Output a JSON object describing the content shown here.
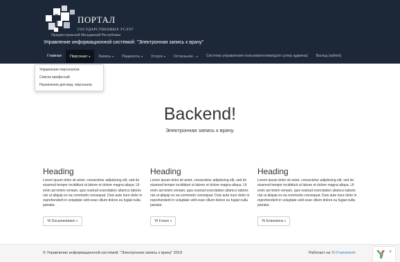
{
  "header": {
    "logo": {
      "title": "ПОРТАЛ",
      "subtitle_line1": "ГОСУДАРСТВЕННЫХ УСЛУГ",
      "subtitle_line2": "Приднестровской Молдавской Республики"
    },
    "system_title": "Управление информационной системой: \"Электронная запись к врачу\""
  },
  "nav": {
    "items": [
      {
        "label": "Главная",
        "has_caret": false
      },
      {
        "label": "Персонал",
        "has_caret": true
      },
      {
        "label": "Запись",
        "has_caret": true
      },
      {
        "label": "Пациенты",
        "has_caret": true
      },
      {
        "label": "Услуги",
        "has_caret": true
      },
      {
        "label": "Остальное..",
        "has_caret": true
      },
      {
        "label": "Система управления пользователями(для супер админа)",
        "has_caret": false
      },
      {
        "label": "Выход (admin)",
        "has_caret": false
      }
    ],
    "caret": "▾",
    "active": "Персонал"
  },
  "dropdown": {
    "items": [
      "Управление персоналом",
      "Список профессий",
      "Назначения для мед. персонала"
    ]
  },
  "jumbotron": {
    "heading": "Backend!",
    "lead": "Электронная запись к врачу."
  },
  "columns": [
    {
      "heading": "Heading",
      "text": "Lorem ipsum dolor sit amet, consectetur adipisicing elit, sed do eiusmod tempor incididunt ut labore et dolore magna aliqua. Ut enim ad minim veniam, quis nostrud exercitation ullamco laboris nisi ut aliquip ex ea commodo consequat. Duis aute irure dolor in reprehenderit in voluptate velit esse cillum dolore eu fugiat nulla pariatur.",
      "button": "Yii Documentation »"
    },
    {
      "heading": "Heading",
      "text": "Lorem ipsum dolor sit amet, consectetur adipisicing elit, sed do eiusmod tempor incididunt ut labore et dolore magna aliqua. Ut enim ad minim veniam, quis nostrud exercitation ullamco laboris nisi ut aliquip ex ea commodo consequat. Duis aute irure dolor in reprehenderit in voluptate velit esse cillum dolore eu fugiat nulla pariatur.",
      "button": "Yii Forum »"
    },
    {
      "heading": "Heading",
      "text": "Lorem ipsum dolor sit amet, consectetur adipisicing elit, sed do eiusmod tempor incididunt ut labore et dolore magna aliqua. Ut enim ad minim veniam, quis nostrud exercitation ullamco laboris nisi ut aliquip ex ea commodo consequat. Duis aute irure dolor in reprehenderit in voluptate velit esse cillum dolore eu fugiat nulla pariatur.",
      "button": "Yii Extensions »"
    }
  ],
  "footer": {
    "copyright": "© Управление информационной системой: \"Электронная запись к врачу\" 2019",
    "powered_prefix": "Работает на",
    "powered_link": "Yii Framework"
  },
  "debug_toolbar": {
    "icon": "yii-logo-icon",
    "close_glyph": "×"
  },
  "colors": {
    "header_bg": "#1c2738",
    "nav_active_bg": "#0f131b",
    "link": "#337ab7",
    "footer_bg": "#f5f5f5"
  }
}
